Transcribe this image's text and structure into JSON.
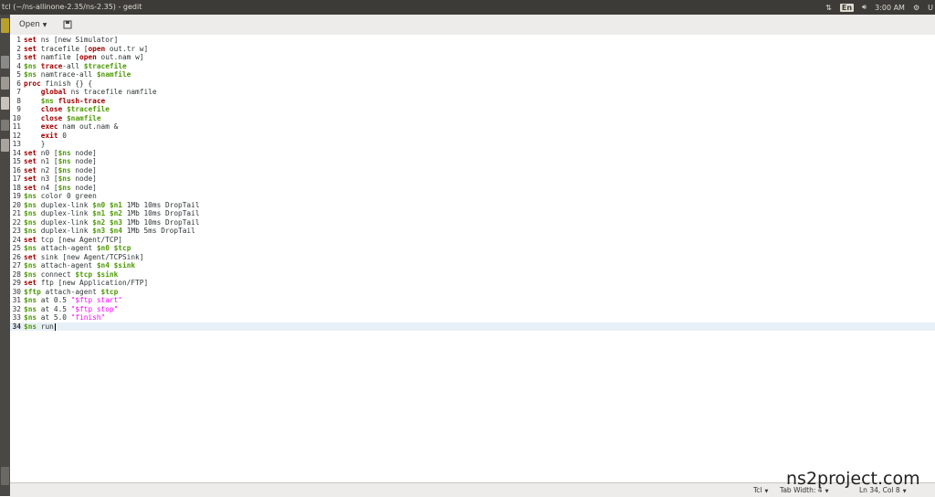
{
  "window": {
    "title": "tcl (~/ns-allinone-2.35/ns-2.35) - gedit"
  },
  "indicators": {
    "lang": "En",
    "time": "3:00 AM",
    "user": "U"
  },
  "toolbar": {
    "open_label": "Open"
  },
  "editor": {
    "current_line": 34,
    "lines": [
      [
        [
          "set",
          "kw"
        ],
        [
          " ns [new Simulator]",
          ""
        ]
      ],
      [
        [
          "set",
          "kw"
        ],
        [
          " tracefile [",
          ""
        ],
        [
          "open",
          "kw"
        ],
        [
          " out.tr w]",
          ""
        ]
      ],
      [
        [
          "set",
          "kw"
        ],
        [
          " namfile [",
          ""
        ],
        [
          "open",
          "kw"
        ],
        [
          " out.nam w]",
          ""
        ]
      ],
      [
        [
          "$ns",
          "vr"
        ],
        [
          " ",
          ""
        ],
        [
          "trace",
          "kw"
        ],
        [
          "-all ",
          ""
        ],
        [
          "$tracefile",
          "vr"
        ]
      ],
      [
        [
          "$ns",
          "vr"
        ],
        [
          " namtrace-all ",
          ""
        ],
        [
          "$namfile",
          "vr"
        ]
      ],
      [
        [
          "proc",
          "kw"
        ],
        [
          " finish {} {",
          ""
        ]
      ],
      [
        [
          "    ",
          ""
        ],
        [
          "global",
          "kw"
        ],
        [
          " ns tracefile namfile",
          ""
        ]
      ],
      [
        [
          "    ",
          ""
        ],
        [
          "$ns",
          "vr"
        ],
        [
          " ",
          ""
        ],
        [
          "flush-trace",
          "kw"
        ]
      ],
      [
        [
          "    ",
          ""
        ],
        [
          "close",
          "kw"
        ],
        [
          " ",
          ""
        ],
        [
          "$tracefile",
          "vr"
        ]
      ],
      [
        [
          "    ",
          ""
        ],
        [
          "close",
          "kw"
        ],
        [
          " ",
          ""
        ],
        [
          "$namfile",
          "vr"
        ]
      ],
      [
        [
          "    ",
          ""
        ],
        [
          "exec",
          "kw"
        ],
        [
          " nam out.nam &",
          ""
        ]
      ],
      [
        [
          "    ",
          ""
        ],
        [
          "exit",
          "kw"
        ],
        [
          " 0",
          ""
        ]
      ],
      [
        [
          "    }",
          ""
        ]
      ],
      [
        [
          "set",
          "kw"
        ],
        [
          " n0 [",
          ""
        ],
        [
          "$ns",
          "vr"
        ],
        [
          " node]",
          ""
        ]
      ],
      [
        [
          "set",
          "kw"
        ],
        [
          " n1 [",
          ""
        ],
        [
          "$ns",
          "vr"
        ],
        [
          " node]",
          ""
        ]
      ],
      [
        [
          "set",
          "kw"
        ],
        [
          " n2 [",
          ""
        ],
        [
          "$ns",
          "vr"
        ],
        [
          " node]",
          ""
        ]
      ],
      [
        [
          "set",
          "kw"
        ],
        [
          " n3 [",
          ""
        ],
        [
          "$ns",
          "vr"
        ],
        [
          " node]",
          ""
        ]
      ],
      [
        [
          "set",
          "kw"
        ],
        [
          " n4 [",
          ""
        ],
        [
          "$ns",
          "vr"
        ],
        [
          " node]",
          ""
        ]
      ],
      [
        [
          "$ns",
          "vr"
        ],
        [
          " color 0 green",
          ""
        ]
      ],
      [
        [
          "$ns",
          "vr"
        ],
        [
          " duplex-link ",
          ""
        ],
        [
          "$n0",
          "vr"
        ],
        [
          " ",
          ""
        ],
        [
          "$n1",
          "vr"
        ],
        [
          " 1Mb 10ms DropTail",
          ""
        ]
      ],
      [
        [
          "$ns",
          "vr"
        ],
        [
          " duplex-link ",
          ""
        ],
        [
          "$n1",
          "vr"
        ],
        [
          " ",
          ""
        ],
        [
          "$n2",
          "vr"
        ],
        [
          " 1Mb 10ms DropTail",
          ""
        ]
      ],
      [
        [
          "$ns",
          "vr"
        ],
        [
          " duplex-link ",
          ""
        ],
        [
          "$n2",
          "vr"
        ],
        [
          " ",
          ""
        ],
        [
          "$n3",
          "vr"
        ],
        [
          " 1Mb 10ms DropTail",
          ""
        ]
      ],
      [
        [
          "$ns",
          "vr"
        ],
        [
          " duplex-link ",
          ""
        ],
        [
          "$n3",
          "vr"
        ],
        [
          " ",
          ""
        ],
        [
          "$n4",
          "vr"
        ],
        [
          " 1Mb 5ms DropTail",
          ""
        ]
      ],
      [
        [
          "set",
          "kw"
        ],
        [
          " tcp [new Agent/TCP]",
          ""
        ]
      ],
      [
        [
          "$ns",
          "vr"
        ],
        [
          " attach-agent ",
          ""
        ],
        [
          "$n0",
          "vr"
        ],
        [
          " ",
          ""
        ],
        [
          "$tcp",
          "vr"
        ]
      ],
      [
        [
          "set",
          "kw"
        ],
        [
          " sink [new Agent/TCPSink]",
          ""
        ]
      ],
      [
        [
          "$ns",
          "vr"
        ],
        [
          " attach-agent ",
          ""
        ],
        [
          "$n4",
          "vr"
        ],
        [
          " ",
          ""
        ],
        [
          "$sink",
          "vr"
        ]
      ],
      [
        [
          "$ns",
          "vr"
        ],
        [
          " connect ",
          ""
        ],
        [
          "$tcp",
          "vr"
        ],
        [
          " ",
          ""
        ],
        [
          "$sink",
          "vr"
        ]
      ],
      [
        [
          "set",
          "kw"
        ],
        [
          " ftp [new Application/FTP]",
          ""
        ]
      ],
      [
        [
          "$ftp",
          "vr"
        ],
        [
          " attach-agent ",
          ""
        ],
        [
          "$tcp",
          "vr"
        ]
      ],
      [
        [
          "$ns",
          "vr"
        ],
        [
          " at 0.5 ",
          ""
        ],
        [
          "\"$ftp start\"",
          "st"
        ]
      ],
      [
        [
          "$ns",
          "vr"
        ],
        [
          " at 4.5 ",
          ""
        ],
        [
          "\"$ftp stop\"",
          "st"
        ]
      ],
      [
        [
          "$ns",
          "vr"
        ],
        [
          " at 5.0 ",
          ""
        ],
        [
          "\"finish\"",
          "st"
        ]
      ],
      [
        [
          "$ns",
          "vr"
        ],
        [
          " run",
          ""
        ]
      ]
    ]
  },
  "statusbar": {
    "language": "Tcl",
    "tab_width": "Tab Width: 4",
    "position": "Ln 34, Col 8"
  },
  "watermark": "ns2project.com",
  "colors": {
    "keyword": "#a40000",
    "variable": "#4e9a06",
    "string": "#ff00ff",
    "panel": "#3c3b37"
  }
}
